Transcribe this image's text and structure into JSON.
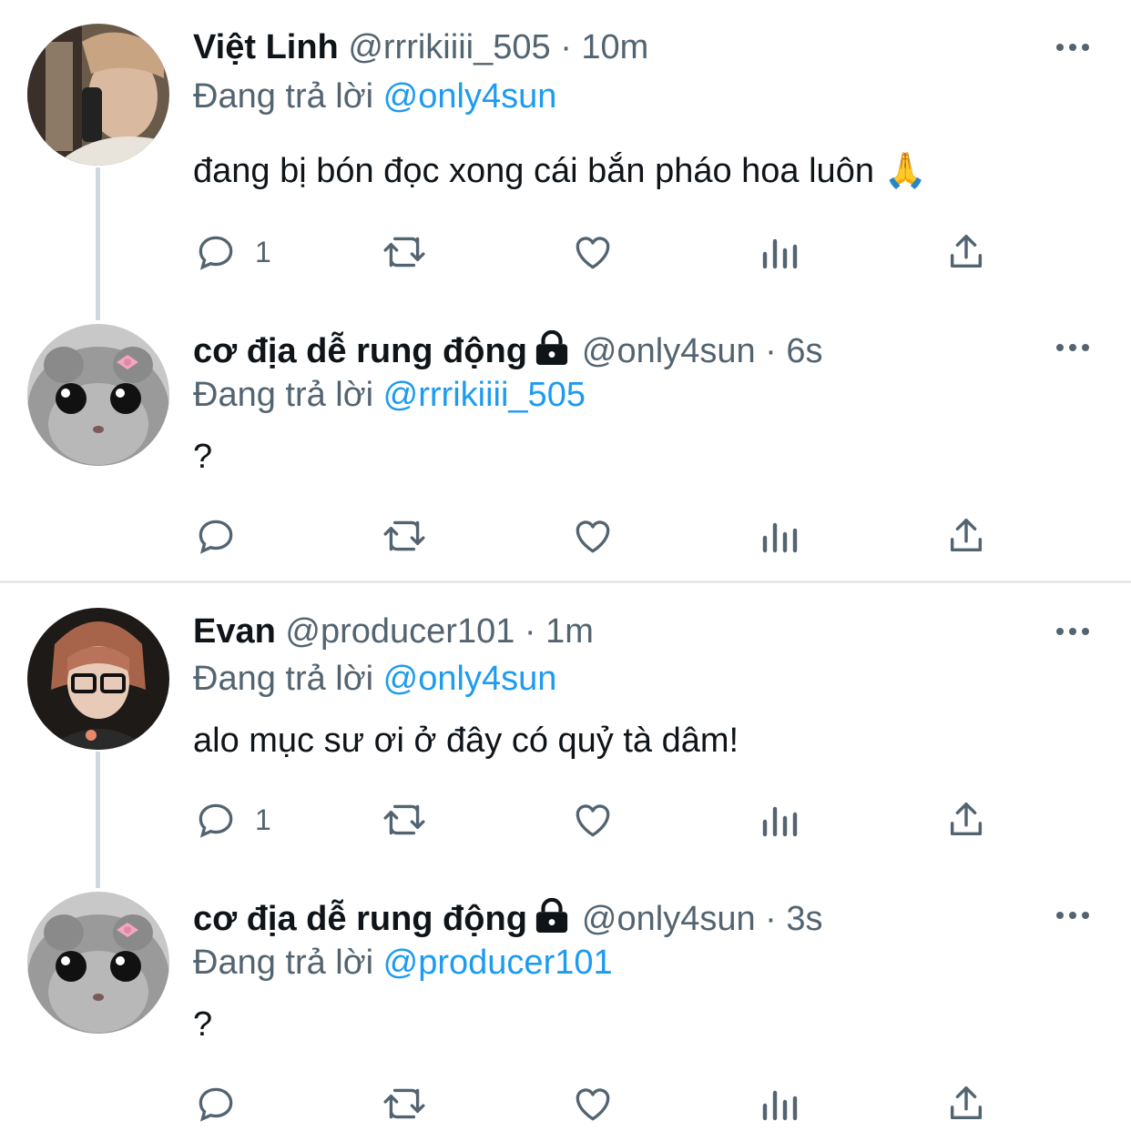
{
  "tweets": [
    {
      "name": "Việt Linh",
      "handle": "@rrrikiiii_505",
      "time": "10m",
      "replying_prefix": "Đang trả lời",
      "replying_to": "@only4sun",
      "text": "đang bị bón đọc xong cái bắn pháo hoa luôn",
      "emoji": "🙏",
      "reply_count": "1",
      "locked": false,
      "avatar": "person-photo"
    },
    {
      "name": "cơ địa dễ rung động",
      "handle": "@only4sun",
      "time": "6s",
      "replying_prefix": "Đang trả lời",
      "replying_to": "@rrrikiiii_505",
      "text": "?",
      "reply_count": "",
      "locked": true,
      "avatar": "hamster"
    },
    {
      "name": "Evan",
      "handle": "@producer101",
      "time": "1m",
      "replying_prefix": "Đang trả lời",
      "replying_to": "@only4sun",
      "text": "alo mục sư ơi ở đây có quỷ tà dâm!",
      "reply_count": "1",
      "locked": false,
      "avatar": "person-glasses"
    },
    {
      "name": "cơ địa dễ rung động",
      "handle": "@only4sun",
      "time": "3s",
      "replying_prefix": "Đang trả lời",
      "replying_to": "@producer101",
      "text": "?",
      "reply_count": "",
      "locked": true,
      "avatar": "hamster"
    }
  ],
  "separator": "·",
  "colors": {
    "link": "#1d9bf0",
    "secondary": "#536471",
    "primary": "#0f1419",
    "thread_line": "#cfd9de"
  }
}
